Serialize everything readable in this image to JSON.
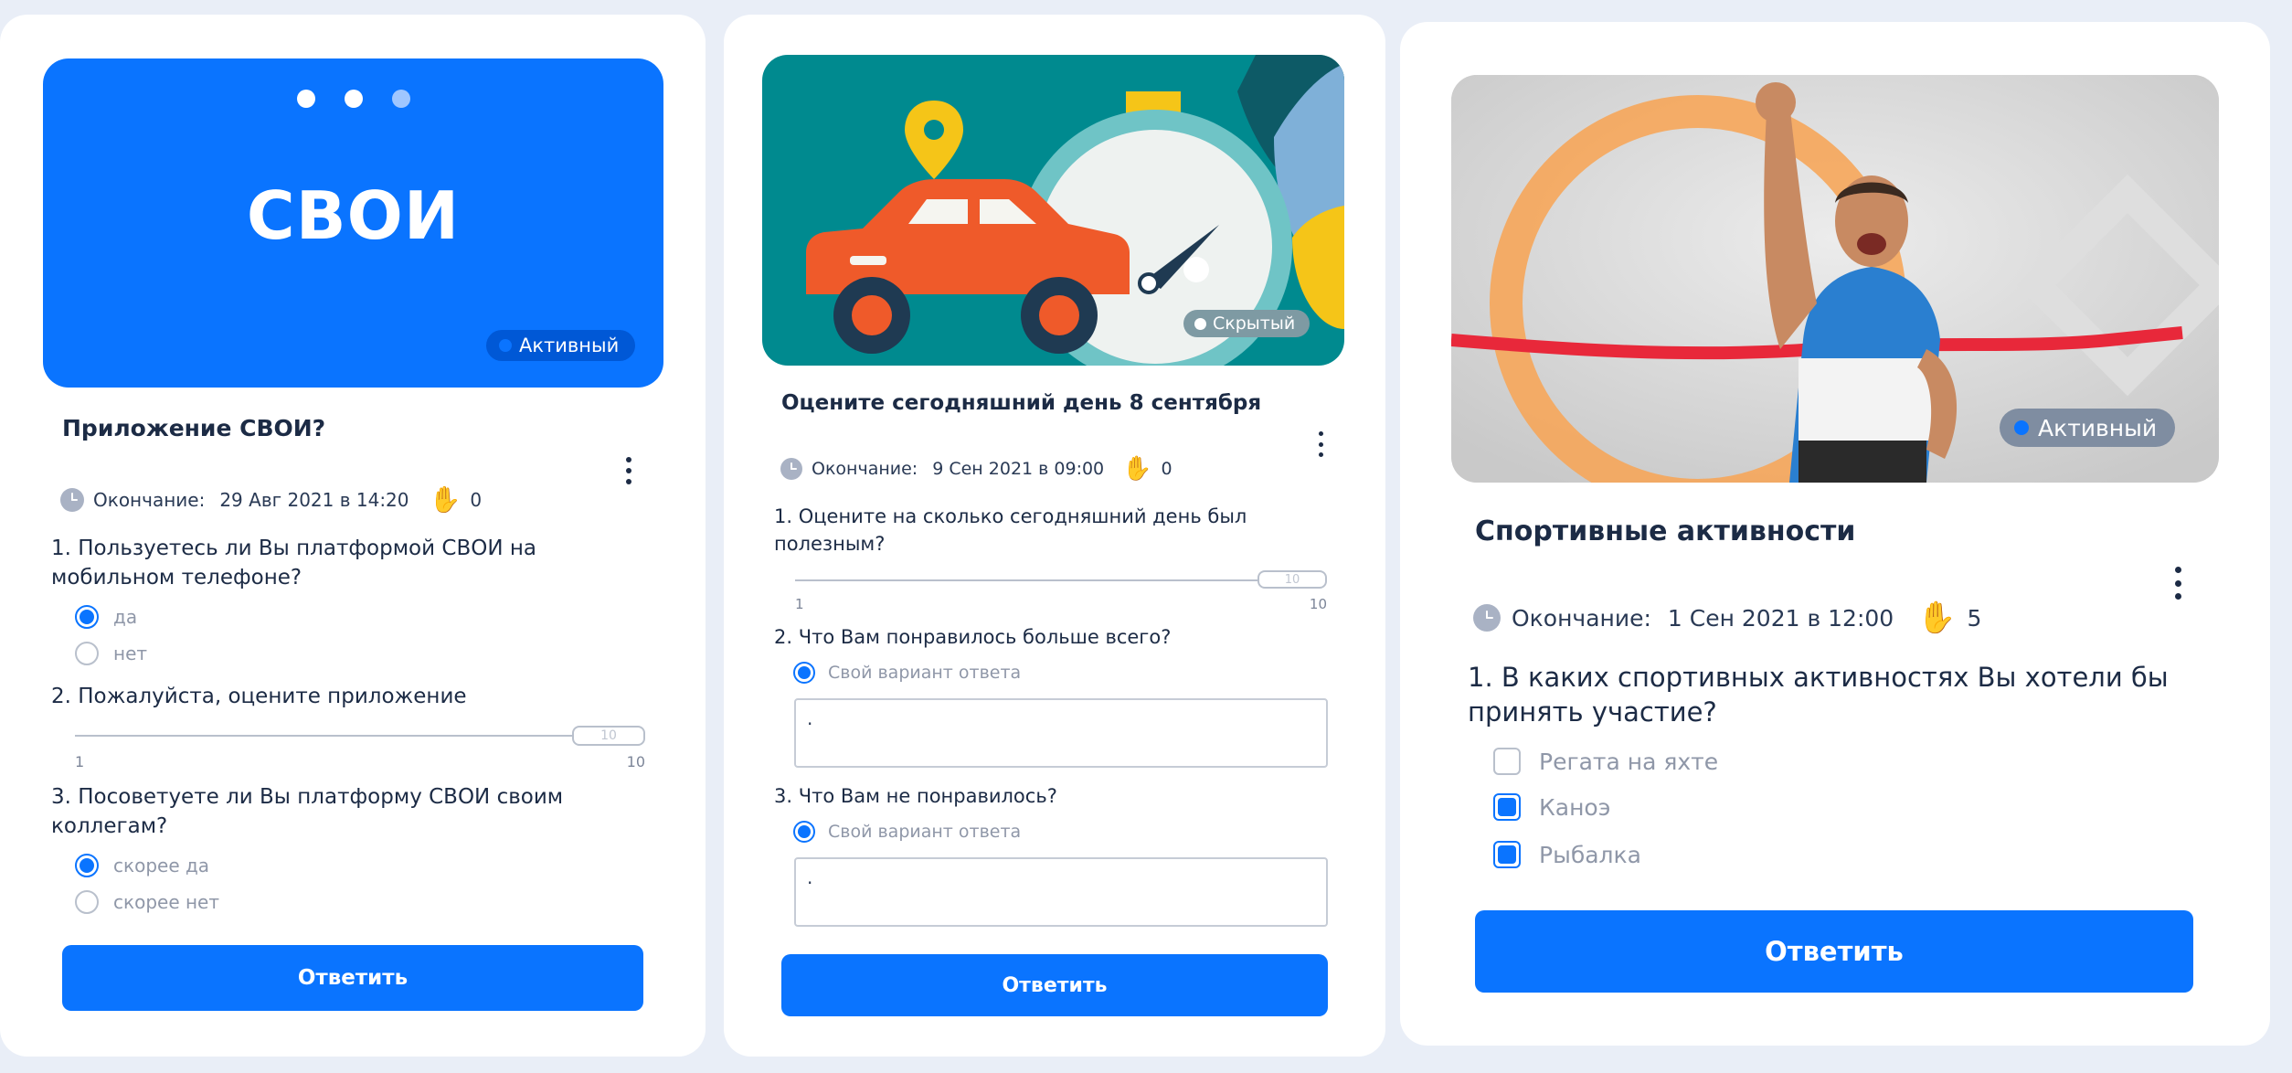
{
  "colors": {
    "accent": "#0a74ff",
    "page_bg": "#e9eef7",
    "card_bg": "#ffffff",
    "text": "#1c2b45"
  },
  "cards": [
    {
      "banner_logo": "СВОИ",
      "status": "Активный",
      "title": "Приложение СВОИ?",
      "end_label": "Окончание:",
      "end_date": "29 Авг 2021 в 14:20",
      "responses": "0",
      "questions": [
        {
          "text": "1. Пользуетесь ли Вы платформой СВОИ на мобильном телефоне?",
          "options": [
            {
              "label": "да",
              "selected": true
            },
            {
              "label": "нет",
              "selected": false
            }
          ]
        },
        {
          "text": "2. Пожалуйста, оцените приложение",
          "slider": {
            "value": "10",
            "min": "1",
            "max": "10"
          }
        },
        {
          "text": "3. Посоветуете ли Вы платформу СВОИ своим коллегам?",
          "options": [
            {
              "label": "скорее да",
              "selected": true
            },
            {
              "label": "скорее нет",
              "selected": false
            }
          ]
        }
      ],
      "button": "Ответить"
    },
    {
      "status": "Скрытый",
      "title": "Оцените сегодняшний день 8 сентября",
      "end_label": "Окончание:",
      "end_date": "9 Сен 2021 в 09:00",
      "responses": "0",
      "questions": [
        {
          "text": "1. Оцените на сколько сегодняшний день был полезным?",
          "slider": {
            "value": "10",
            "min": "1",
            "max": "10"
          }
        },
        {
          "text": "2. Что Вам понравилось больше всего?",
          "options": [
            {
              "label": "Свой вариант ответа",
              "selected": true
            }
          ],
          "answer": "."
        },
        {
          "text": "3. Что Вам не понравилось?",
          "options": [
            {
              "label": "Свой вариант ответа",
              "selected": true
            }
          ],
          "answer": "."
        }
      ],
      "button": "Ответить"
    },
    {
      "status": "Активный",
      "title": "Спортивные активности",
      "end_label": "Окончание:",
      "end_date": "1 Сен 2021 в 12:00",
      "responses": "5",
      "questions": [
        {
          "text": "1. В каких спортивных активностях Вы хотели бы принять участие?",
          "checkboxes": [
            {
              "label": "Регата на яхте",
              "checked": false
            },
            {
              "label": "Каноэ",
              "checked": true
            },
            {
              "label": "Рыбалка",
              "checked": true
            }
          ]
        }
      ],
      "button": "Ответить"
    }
  ]
}
